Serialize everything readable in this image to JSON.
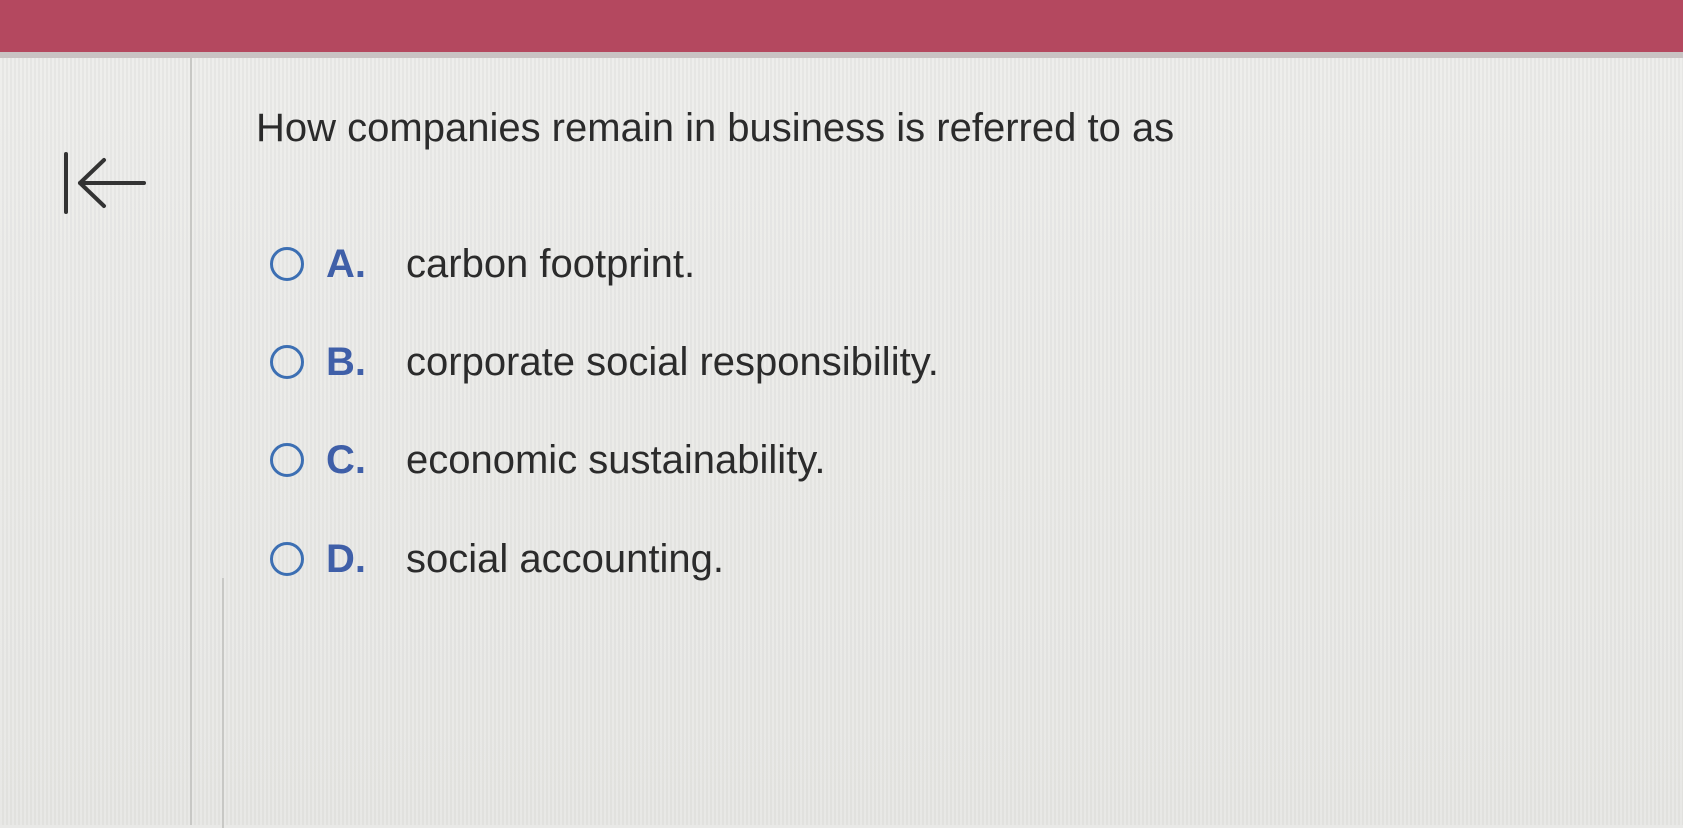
{
  "question": {
    "text": "How companies remain in business is referred to as"
  },
  "options": [
    {
      "letter": "A.",
      "text": "carbon footprint."
    },
    {
      "letter": "B.",
      "text": "corporate social responsibility."
    },
    {
      "letter": "C.",
      "text": "economic sustainability."
    },
    {
      "letter": "D.",
      "text": "social accounting."
    }
  ],
  "icons": {
    "back": "back-to-start-arrow-icon"
  },
  "colors": {
    "header_bar": "#b4485f",
    "radio_border": "#3c6fb3",
    "option_letter": "#3f5fa8",
    "text": "#2b2b2b"
  }
}
